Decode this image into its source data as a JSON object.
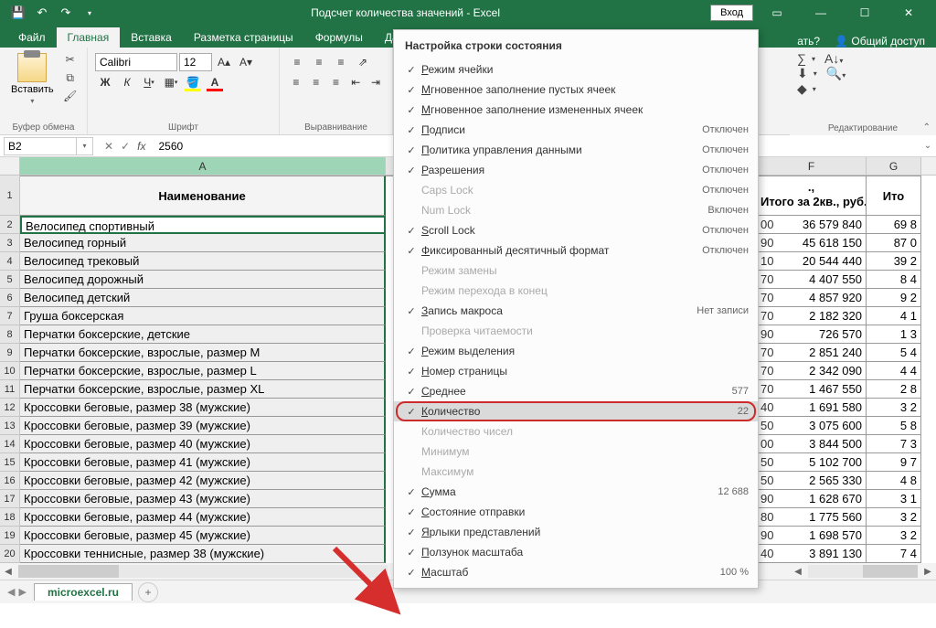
{
  "titlebar": {
    "title": "Подсчет количества значений  -  Excel",
    "login": "Вход"
  },
  "tabs": {
    "file": "Файл",
    "home": "Главная",
    "insert": "Вставка",
    "layout": "Разметка страницы",
    "formulas": "Формулы",
    "data": "Данн",
    "help_q": "ать?",
    "share": "Общий доступ"
  },
  "ribbon": {
    "clipboard": {
      "label": "Буфер обмена",
      "paste": "Вставить"
    },
    "font": {
      "label": "Шрифт",
      "name": "Calibri",
      "size": "12"
    },
    "align": {
      "label": "Выравнивание"
    },
    "editing": {
      "label": "Редактирование"
    }
  },
  "namebox": {
    "ref": "B2",
    "fx": "fx",
    "formula": "2560"
  },
  "columns": {
    "A": "A",
    "F": "F",
    "G": "G"
  },
  "header_row": {
    "A": "Наименование",
    "F": "Итого за 2кв., руб.",
    "G": "Ито",
    "Fsuffix_top": ".,"
  },
  "data_rows": [
    {
      "n": 2,
      "A": "Велосипед спортивный",
      "Fpre": "00",
      "F": "36 579 840",
      "G": "69 8"
    },
    {
      "n": 3,
      "A": "Велосипед горный",
      "Fpre": "90",
      "F": "45 618 150",
      "G": "87 0"
    },
    {
      "n": 4,
      "A": "Велосипед трековый",
      "Fpre": "10",
      "F": "20 544 440",
      "G": "39 2"
    },
    {
      "n": 5,
      "A": "Велосипед дорожный",
      "Fpre": "70",
      "F": "4 407 550",
      "G": "8 4"
    },
    {
      "n": 6,
      "A": "Велосипед детский",
      "Fpre": "70",
      "F": "4 857 920",
      "G": "9 2"
    },
    {
      "n": 7,
      "A": "Груша боксерская",
      "Fpre": "70",
      "F": "2 182 320",
      "G": "4 1"
    },
    {
      "n": 8,
      "A": "Перчатки боксерские, детские",
      "Fpre": "90",
      "F": "726 570",
      "G": "1 3"
    },
    {
      "n": 9,
      "A": "Перчатки боксерские, взрослые, размер M",
      "Fpre": "70",
      "F": "2 851 240",
      "G": "5 4"
    },
    {
      "n": 10,
      "A": "Перчатки боксерские, взрослые, размер L",
      "Fpre": "70",
      "F": "2 342 090",
      "G": "4 4"
    },
    {
      "n": 11,
      "A": "Перчатки боксерские, взрослые, размер XL",
      "Fpre": "70",
      "F": "1 467 550",
      "G": "2 8"
    },
    {
      "n": 12,
      "A": "Кроссовки беговые, размер 38 (мужские)",
      "Fpre": "40",
      "F": "1 691 580",
      "G": "3 2"
    },
    {
      "n": 13,
      "A": "Кроссовки беговые, размер 39 (мужские)",
      "Fpre": "50",
      "F": "3 075 600",
      "G": "5 8"
    },
    {
      "n": 14,
      "A": "Кроссовки беговые, размер 40 (мужские)",
      "Fpre": "00",
      "F": "3 844 500",
      "G": "7 3"
    },
    {
      "n": 15,
      "A": "Кроссовки беговые, размер 41 (мужские)",
      "Fpre": "50",
      "F": "5 102 700",
      "G": "9 7"
    },
    {
      "n": 16,
      "A": "Кроссовки беговые, размер 42 (мужские)",
      "Fpre": "50",
      "F": "2 565 330",
      "G": "4 8"
    },
    {
      "n": 17,
      "A": "Кроссовки беговые, размер 43 (мужские)",
      "Fpre": "90",
      "F": "1 628 670",
      "G": "3 1"
    },
    {
      "n": 18,
      "A": "Кроссовки беговые, размер 44 (мужские)",
      "Fpre": "80",
      "F": "1 775 560",
      "G": "3 2"
    },
    {
      "n": 19,
      "A": "Кроссовки беговые, размер 45 (мужские)",
      "Fpre": "90",
      "F": "1 698 570",
      "G": "3 2"
    },
    {
      "n": 20,
      "A": "Кроссовки теннисные, размер 38 (мужские)",
      "Fpre": "40",
      "F": "3 891 130",
      "G": "7 4"
    }
  ],
  "sheet": {
    "tab": "microexcel.ru"
  },
  "context_menu": {
    "title": "Настройка строки состояния",
    "items": [
      {
        "chk": true,
        "label": "Режим ячейки",
        "u": 0
      },
      {
        "chk": true,
        "label": "Мгновенное заполнение пустых ячеек",
        "u": 0
      },
      {
        "chk": true,
        "label": "Мгновенное заполнение измененных ячеек",
        "u": 0
      },
      {
        "chk": true,
        "label": "Подписи",
        "u": 0,
        "status": "Отключен"
      },
      {
        "chk": true,
        "label": "Политика управления данными",
        "u": 0,
        "status": "Отключен"
      },
      {
        "chk": true,
        "label": "Разрешения",
        "u": 0,
        "status": "Отключен"
      },
      {
        "chk": false,
        "label": "Caps Lock",
        "status": "Отключен",
        "disabled": true
      },
      {
        "chk": false,
        "label": "Num Lock",
        "status": "Включен",
        "disabled": true
      },
      {
        "chk": true,
        "label": "Scroll Lock",
        "u": 0,
        "status": "Отключен"
      },
      {
        "chk": true,
        "label": "Фиксированный десятичный формат",
        "u": 0,
        "status": "Отключен"
      },
      {
        "chk": false,
        "label": "Режим замены",
        "disabled": true
      },
      {
        "chk": false,
        "label": "Режим перехода в конец",
        "disabled": true
      },
      {
        "chk": true,
        "label": "Запись макроса",
        "u": 0,
        "status": "Нет записи"
      },
      {
        "chk": false,
        "label": "Проверка читаемости",
        "disabled": true
      },
      {
        "chk": true,
        "label": "Режим выделения",
        "u": 0
      },
      {
        "chk": true,
        "label": "Номер страницы",
        "u": 0
      },
      {
        "chk": true,
        "label": "Среднее",
        "u": 0,
        "status": "577"
      },
      {
        "chk": true,
        "label": "Количество",
        "u": 0,
        "status": "22",
        "highlight": true
      },
      {
        "chk": false,
        "label": "Количество чисел",
        "disabled": true
      },
      {
        "chk": false,
        "label": "Минимум",
        "disabled": true
      },
      {
        "chk": false,
        "label": "Максимум",
        "disabled": true
      },
      {
        "chk": true,
        "label": "Сумма",
        "u": 0,
        "status": "12 688"
      },
      {
        "chk": true,
        "label": "Состояние отправки",
        "u": 0
      },
      {
        "chk": true,
        "label": "Ярлыки представлений",
        "u": 0
      },
      {
        "chk": true,
        "label": "Ползунок масштаба",
        "u": 0
      },
      {
        "chk": true,
        "label": "Масштаб",
        "u": 0,
        "status": "100 %"
      }
    ]
  }
}
